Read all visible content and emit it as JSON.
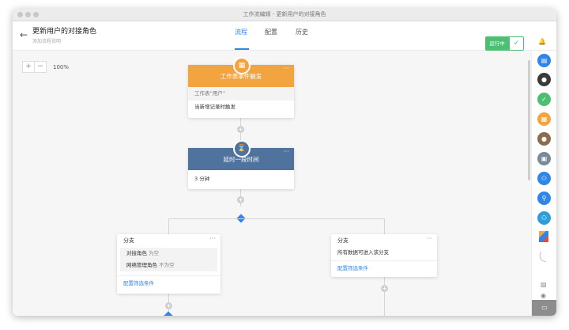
{
  "window": {
    "title": "工作流编辑 - 更新用户的对接角色"
  },
  "header": {
    "title": "更新用户的对接角色",
    "subtitle": "添加流程说明",
    "tabs": [
      {
        "label": "流程"
      },
      {
        "label": "配置"
      },
      {
        "label": "历史"
      }
    ],
    "run_status": "运行中",
    "icons": {
      "back": "arrow-left-icon",
      "check": "check-icon",
      "bell": "bell-icon"
    }
  },
  "canvas": {
    "zoom": {
      "minus": "−",
      "plus": "+",
      "level": "100%"
    },
    "trigger_node": {
      "title": "工作表事件触发",
      "table": "工作表“用户”",
      "condition": "当新增记录时触发",
      "color": "#f2a440"
    },
    "delay_node": {
      "title": "延时一段时间",
      "value": "3 分钟",
      "color": "#50739e"
    },
    "branch_left": {
      "title": "分支",
      "conditions": [
        {
          "field": "对接角色",
          "op": "为空"
        },
        {
          "field": "网络管理角色",
          "op": "不为空"
        }
      ],
      "link": "配置筛选条件"
    },
    "branch_right": {
      "title": "分支",
      "condition": "所有数据可进入该分支",
      "link": "配置筛选条件"
    },
    "accent": "#2f86e8"
  },
  "sidebar": {
    "icons": [
      {
        "name": "chat-icon",
        "color": "#2f86e8"
      },
      {
        "name": "avatar-icon",
        "color": "#3a3a3a"
      },
      {
        "name": "check-circle-icon",
        "color": "#4cbf72"
      },
      {
        "name": "apps-icon",
        "color": "#f2a440"
      },
      {
        "name": "avatar-icon",
        "color": "#8c6d4b"
      },
      {
        "name": "briefcase-icon",
        "color": "#7a8a99"
      },
      {
        "name": "group-icon",
        "color": "#2f86e8"
      },
      {
        "name": "org-chart-icon",
        "color": "#2f86e8"
      },
      {
        "name": "team-icon",
        "color": "#2f9dd8"
      }
    ]
  }
}
